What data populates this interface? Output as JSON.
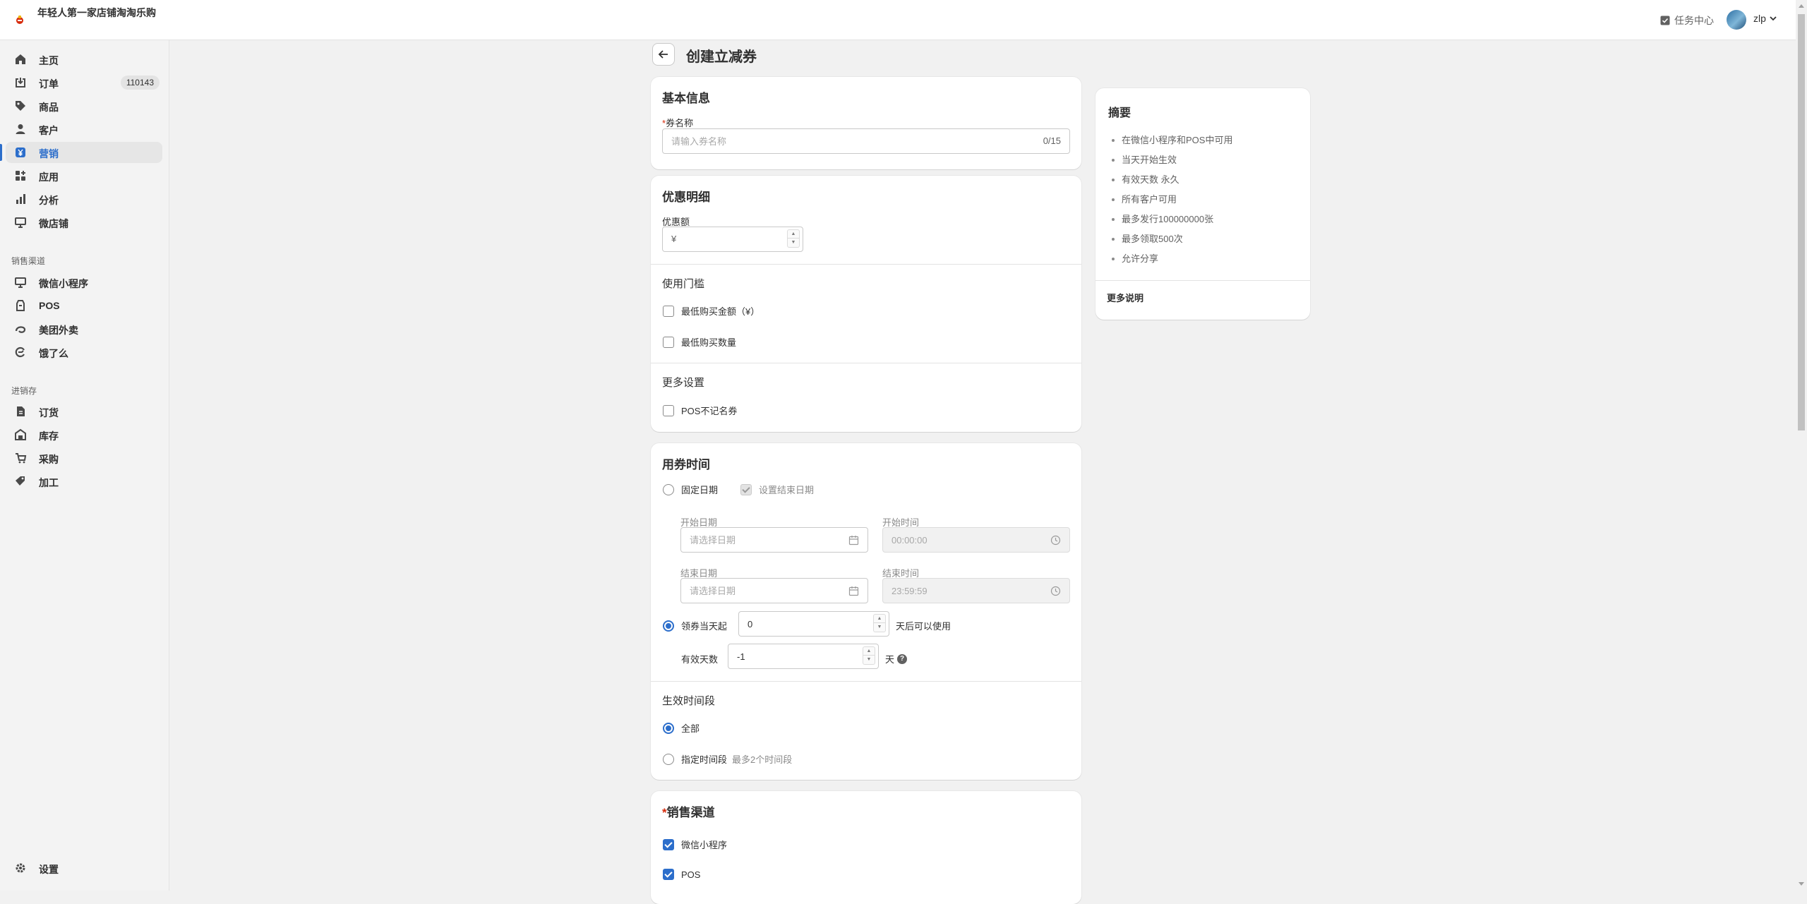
{
  "store": {
    "name": "年轻人第一家店铺淘淘乐购"
  },
  "topbar": {
    "task_center": "任务中心",
    "user_name": "zlp"
  },
  "sidebar": {
    "main_items": [
      {
        "label": "主页",
        "icon": "home-icon"
      },
      {
        "label": "订单",
        "icon": "orders-icon",
        "badge": "110143"
      },
      {
        "label": "商品",
        "icon": "tag-icon"
      },
      {
        "label": "客户",
        "icon": "person-icon"
      },
      {
        "label": "营销",
        "icon": "yen-icon",
        "active": true
      },
      {
        "label": "应用",
        "icon": "apps-icon"
      },
      {
        "label": "分析",
        "icon": "analytics-icon"
      },
      {
        "label": "微店铺",
        "icon": "storefront-icon"
      }
    ],
    "sales_channels_heading": "销售渠道",
    "sales_channels": [
      {
        "label": "微信小程序",
        "icon": "monitor-icon"
      },
      {
        "label": "POS",
        "icon": "pos-icon"
      },
      {
        "label": "美团外卖",
        "icon": "meituan-icon"
      },
      {
        "label": "饿了么",
        "icon": "eleme-icon"
      }
    ],
    "inventory_heading": "进销存",
    "inventory_items": [
      {
        "label": "订货",
        "icon": "document-icon"
      },
      {
        "label": "库存",
        "icon": "warehouse-icon"
      },
      {
        "label": "采购",
        "icon": "cart-icon"
      },
      {
        "label": "加工",
        "icon": "process-icon"
      }
    ],
    "settings": "设置"
  },
  "page": {
    "title": "创建立减券"
  },
  "basic_info": {
    "title": "基本信息",
    "name_label": "券名称",
    "name_placeholder": "请输入券名称",
    "name_counter": "0/15"
  },
  "discount": {
    "title": "优惠明细",
    "amount_label": "优惠额",
    "currency_prefix": "¥",
    "threshold_heading": "使用门槛",
    "min_amount_label": "最低购买金额（¥）",
    "min_qty_label": "最低购买数量",
    "more_heading": "更多设置",
    "pos_anonymous_label": "POS不记名券"
  },
  "usage_time": {
    "title": "用券时间",
    "fixed_date_label": "固定日期",
    "set_end_date_label": "设置结束日期",
    "start_date_label": "开始日期",
    "start_date_placeholder": "请选择日期",
    "start_time_label": "开始时间",
    "start_time_value": "00:00:00",
    "end_date_label": "结束日期",
    "end_date_placeholder": "请选择日期",
    "end_time_label": "结束时间",
    "end_time_value": "23:59:59",
    "from_claim_label": "领券当天起",
    "from_claim_days": "0",
    "from_claim_suffix": "天后可以使用",
    "valid_days_label": "有效天数",
    "valid_days_value": "-1",
    "valid_days_suffix": "天",
    "period_heading": "生效时间段",
    "all_label": "全部",
    "specific_label": "指定时间段",
    "specific_hint": "最多2个时间段"
  },
  "channels": {
    "title": "销售渠道",
    "options": [
      {
        "label": "微信小程序",
        "checked": true
      },
      {
        "label": "POS",
        "checked": true
      }
    ]
  },
  "summary": {
    "title": "摘要",
    "items": [
      "在微信小程序和POS中可用",
      "当天开始生效",
      "有效天数 永久",
      "所有客户可用",
      "最多发行100000000张",
      "最多领取500次",
      "允许分享"
    ],
    "more_label": "更多说明"
  },
  "colors": {
    "accent": "#2c6ecb",
    "required": "#d72c0d"
  }
}
